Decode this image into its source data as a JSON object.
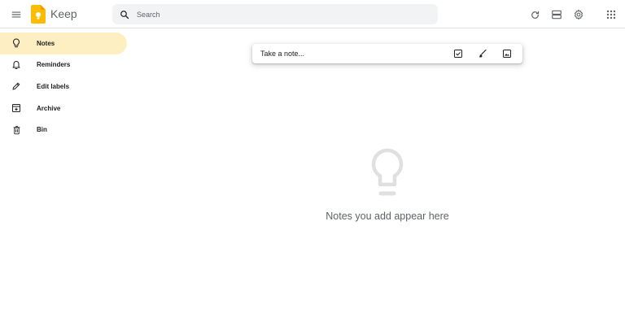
{
  "header": {
    "app_title": "Keep",
    "search_placeholder": "Search",
    "icons": [
      "menu-icon",
      "keep-logo",
      "search-icon",
      "refresh-icon",
      "list-view-icon",
      "settings-icon",
      "apps-grid-icon"
    ]
  },
  "sidebar": {
    "items": [
      {
        "label": "Notes",
        "icon": "lightbulb-icon",
        "active": true
      },
      {
        "label": "Reminders",
        "icon": "bell-icon",
        "active": false
      },
      {
        "label": "Edit labels",
        "icon": "pencil-icon",
        "active": false
      },
      {
        "label": "Archive",
        "icon": "archive-icon",
        "active": false
      },
      {
        "label": "Bin",
        "icon": "trash-icon",
        "active": false
      }
    ]
  },
  "take_note": {
    "placeholder": "Take a note...",
    "icons": [
      "checkbox-icon",
      "brush-icon",
      "image-icon"
    ]
  },
  "empty_state": {
    "message": "Notes you add appear here"
  },
  "colors": {
    "active_item_bg": "#feefc3",
    "logo_yellow": "#fbbc04",
    "search_bg": "#f1f3f4",
    "muted_text": "#5f6368",
    "bulb_gray": "#e0e0e0"
  }
}
